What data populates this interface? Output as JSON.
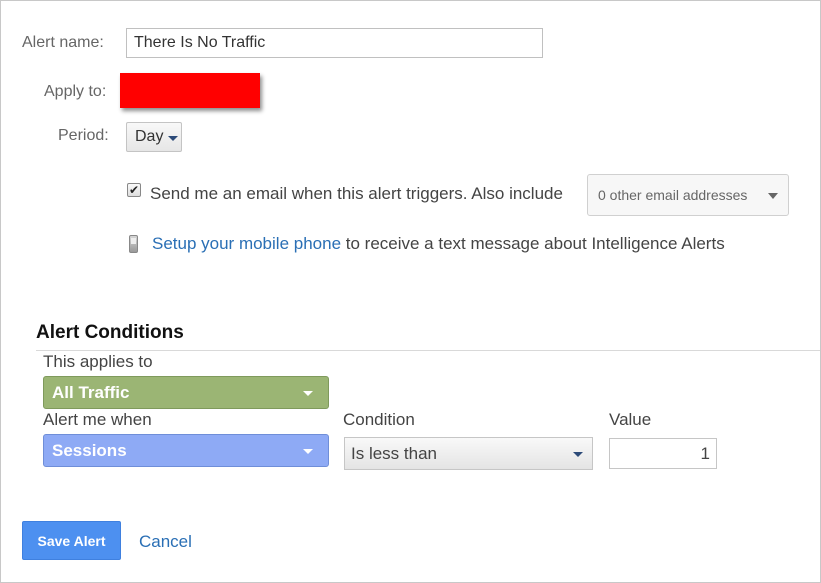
{
  "form": {
    "alert_name_label": "Alert name:",
    "alert_name_value": "There Is No Traffic",
    "apply_to_label": "Apply to:",
    "period_label": "Period:",
    "period_value": "Day",
    "email_checkbox_checked": true,
    "email_checkbox_mark": "✔",
    "email_text": "Send me an email when this alert triggers. Also include",
    "other_emails_value": "0 other email addresses",
    "mobile_link": "Setup your mobile phone",
    "mobile_text": " to receive a text message about Intelligence Alerts"
  },
  "conditions": {
    "title": "Alert Conditions",
    "applies_to_label": "This applies to",
    "applies_to_value": "All Traffic",
    "applies_to_color": "#9bb574",
    "alert_when_label": "Alert me when",
    "alert_when_value": "Sessions",
    "alert_when_color": "#8eaaf5",
    "condition_label": "Condition",
    "condition_value": "Is less than",
    "value_label": "Value",
    "value_value": "1"
  },
  "actions": {
    "save_label": "Save Alert",
    "cancel_label": "Cancel"
  }
}
